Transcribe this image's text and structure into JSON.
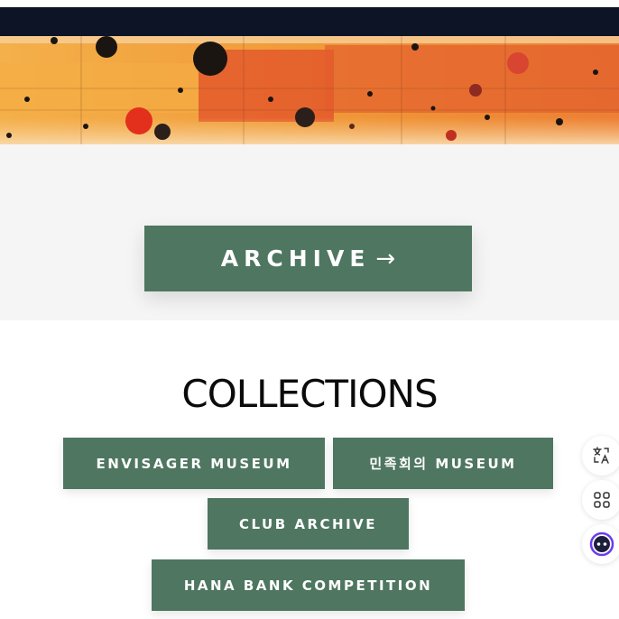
{
  "archive": {
    "label": "ARCHIVE",
    "arrow": "→"
  },
  "collections": {
    "title": "COLLECTIONS",
    "items": [
      {
        "label": "ENVISAGER MUSEUM"
      },
      {
        "label": "민족회의 MUSEUM"
      },
      {
        "label": "CLUB ARCHIVE"
      },
      {
        "label": "HANA BANK COMPETITION"
      }
    ]
  },
  "floating_tools": {
    "icons": [
      "translate-icon",
      "apps-grid-icon",
      "assistant-face-icon"
    ]
  },
  "colors": {
    "top_bar": "#0c1426",
    "button_green": "#4e7660",
    "archive_section_bg": "#f5f5f6",
    "hero_orange": "#f2a640",
    "hero_red": "#e2502a",
    "assistant_accent": "#6a3cf0"
  }
}
